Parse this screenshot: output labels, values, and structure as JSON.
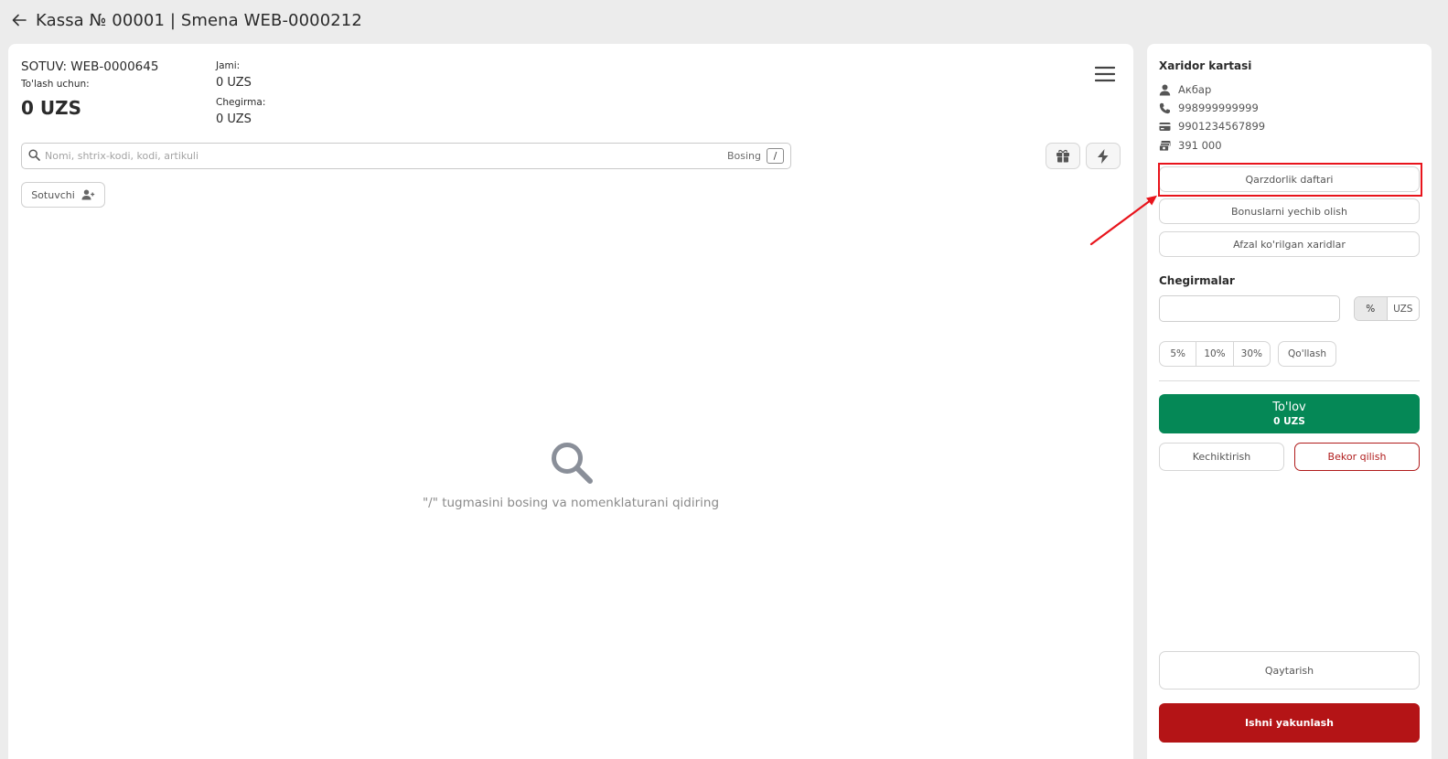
{
  "header": {
    "title": "Kassa № 00001 | Smena WEB-0000212"
  },
  "sale": {
    "id": "SOTUV: WEB-0000645",
    "pay_label": "To'lash uchun:",
    "pay_amount": "0 UZS",
    "total_label": "Jami:",
    "total_value": "0 UZS",
    "discount_label": "Chegirma:",
    "discount_value": "0 UZS"
  },
  "search": {
    "placeholder": "Nomi, shtrix-kodi, kodi, artikuli",
    "hint": "Bosing",
    "key": "/"
  },
  "seller": {
    "label": "Sotuvchi"
  },
  "empty_state": {
    "text": "\"/\" tugmasini bosing va nomenklaturani qidiring"
  },
  "customer": {
    "title": "Xaridor kartasi",
    "name": "Акбар",
    "phone": "998999999999",
    "card": "9901234567899",
    "balance": "391 000"
  },
  "actions": {
    "debt_book": "Qarzdorlik daftari",
    "withdraw_bonus": "Bonuslarni yechib olish",
    "favorites": "Afzal ko'rilgan xaridlar"
  },
  "discounts": {
    "title": "Chegirmalar",
    "input_value": "",
    "unit_percent": "%",
    "unit_currency": "UZS",
    "presets": [
      "5%",
      "10%",
      "30%"
    ],
    "apply": "Qo'llash"
  },
  "payment": {
    "label": "To'lov",
    "amount": "0 UZS",
    "defer": "Kechiktirish",
    "cancel": "Bekor qilish",
    "return": "Qaytarish",
    "finish": "Ishni yakunlash"
  },
  "colors": {
    "pay_green": "#058856",
    "finish_red": "#b41416",
    "annotation_red": "#e8141c"
  }
}
